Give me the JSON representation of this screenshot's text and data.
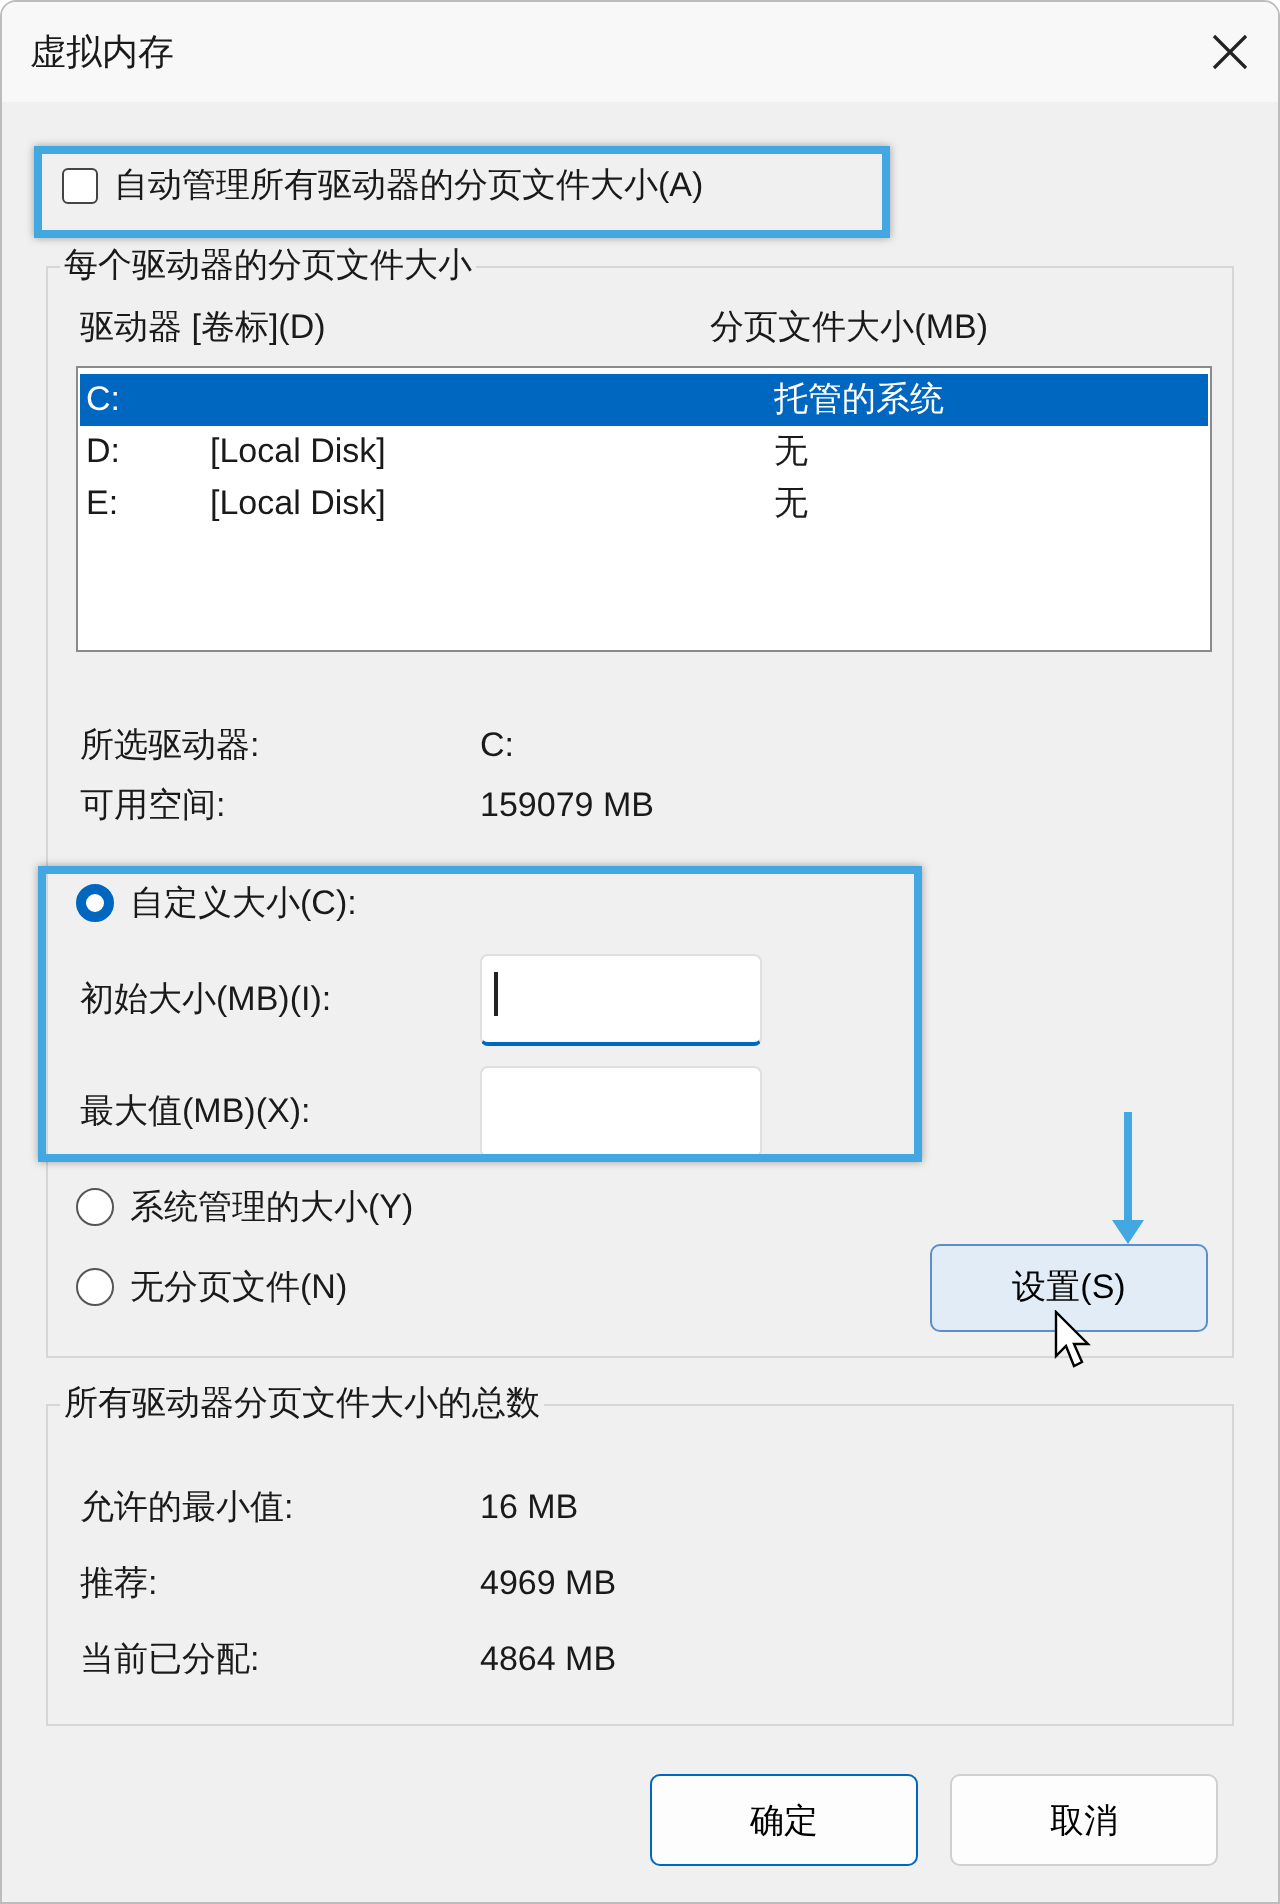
{
  "window": {
    "title": "虚拟内存"
  },
  "auto_manage": {
    "label": "自动管理所有驱动器的分页文件大小(A)",
    "checked": false
  },
  "drives_group": {
    "title": "每个驱动器的分页文件大小",
    "columns": [
      "驱动器 [卷标](D)",
      "分页文件大小(MB)"
    ],
    "rows": [
      {
        "drive": "C:",
        "size": "托管的系统",
        "selected": true
      },
      {
        "drive": "D:",
        "volume": "[Local Disk]",
        "size": "无",
        "selected": false
      },
      {
        "drive": "E:",
        "volume": "[Local Disk]",
        "size": "无",
        "selected": false
      }
    ],
    "info": [
      {
        "label": "所选驱动器:",
        "value": "C:"
      },
      {
        "label": "可用空间:",
        "value": "159079 MB"
      }
    ],
    "size_options": [
      {
        "label": "自定义大小(C):",
        "selected": true
      },
      {
        "label": "系统管理的大小(Y)",
        "selected": false
      },
      {
        "label": "无分页文件(N)",
        "selected": false
      }
    ],
    "custom_fields": [
      {
        "label": "初始大小(MB)(I):",
        "focused": true
      },
      {
        "label": "最大值(MB)(X):",
        "focused": false
      }
    ],
    "set_button": "设置(S)"
  },
  "totals": {
    "title": "所有驱动器分页文件大小的总数",
    "rows": [
      {
        "label": "允许的最小值:",
        "value": "16 MB"
      },
      {
        "label": "推荐:",
        "value": "4969 MB"
      },
      {
        "label": "当前已分配:",
        "value": "4864 MB"
      }
    ]
  },
  "buttons": [
    {
      "label": "确定",
      "default": true
    },
    {
      "label": "取消",
      "default": false
    }
  ]
}
